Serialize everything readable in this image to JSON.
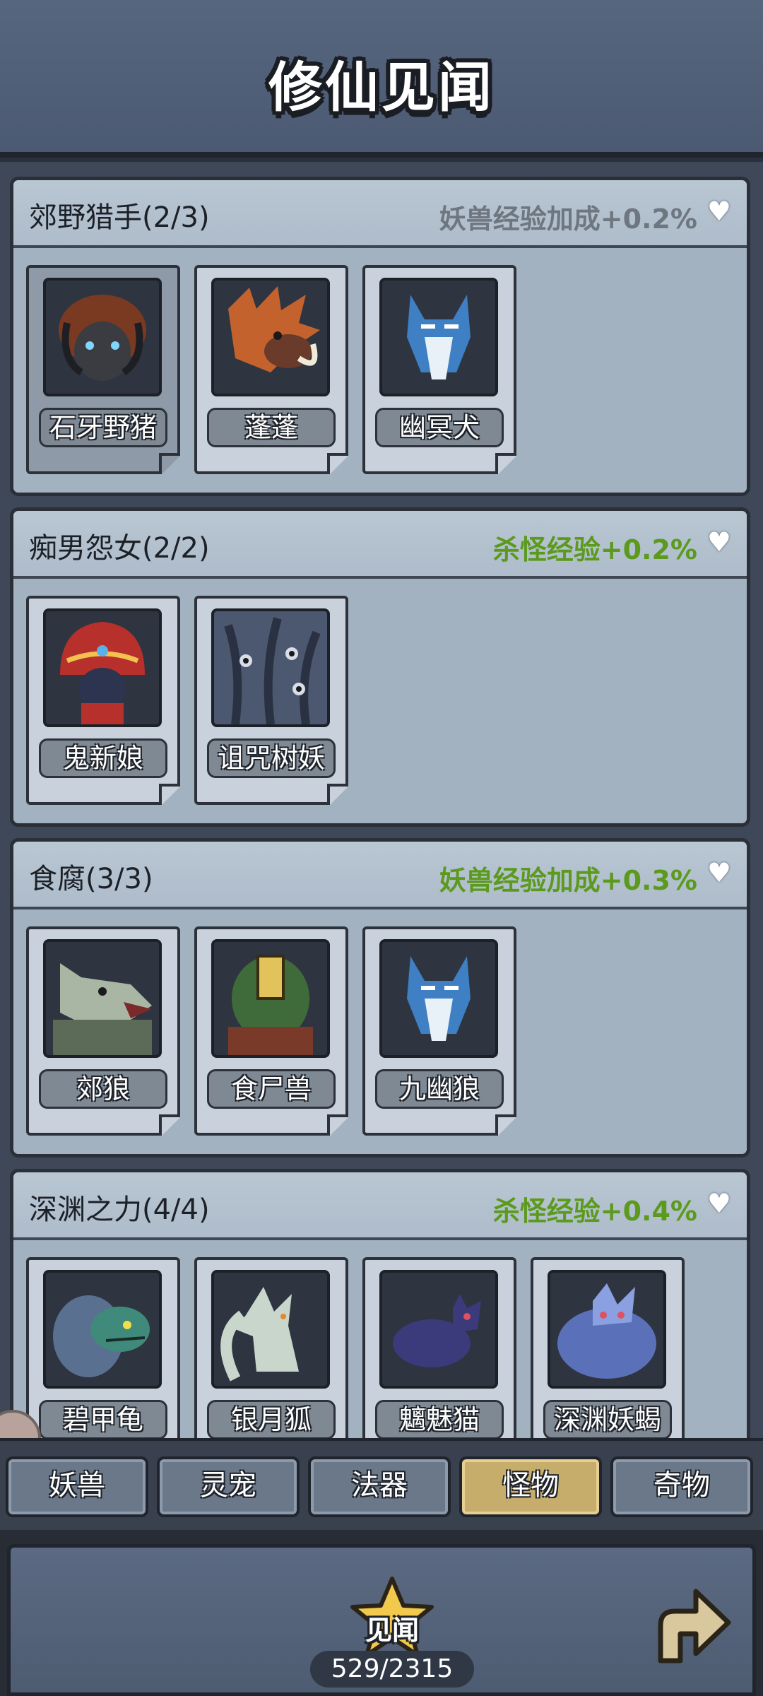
{
  "header": {
    "title": "修仙见闻"
  },
  "sets": [
    {
      "name": "郊野猎手(2/3)",
      "bonus": "妖兽经验加成+0.2%",
      "bonus_active": false,
      "monsters": [
        {
          "name": "石牙野猪",
          "icon": "boar-portrait",
          "color": "#7a3a22",
          "selected": true
        },
        {
          "name": "蓬蓬",
          "icon": "spiky-boar-portrait",
          "color": "#c4622e",
          "selected": false
        },
        {
          "name": "幽冥犬",
          "icon": "blue-wolf-portrait",
          "color": "#3f7fc4",
          "selected": false
        }
      ]
    },
    {
      "name": "痴男怨女(2/2)",
      "bonus": "杀怪经验+0.2%",
      "bonus_active": true,
      "monsters": [
        {
          "name": "鬼新娘",
          "icon": "ghost-bride-portrait",
          "color": "#b8302c",
          "selected": false
        },
        {
          "name": "诅咒树妖",
          "icon": "cursed-tree-portrait",
          "color": "#4c5870",
          "selected": false
        }
      ]
    },
    {
      "name": "食腐(3/3)",
      "bonus": "妖兽经验加成+0.3%",
      "bonus_active": true,
      "monsters": [
        {
          "name": "郊狼",
          "icon": "coyote-portrait",
          "color": "#a9b6a4",
          "selected": false
        },
        {
          "name": "食尸兽",
          "icon": "ghoul-portrait",
          "color": "#3f6b3a",
          "selected": false
        },
        {
          "name": "九幽狼",
          "icon": "blue-wolf-portrait",
          "color": "#3f7fc4",
          "selected": false
        }
      ]
    },
    {
      "name": "深渊之力(4/4)",
      "bonus": "杀怪经验+0.4%",
      "bonus_active": true,
      "monsters": [
        {
          "name": "碧甲龟",
          "icon": "turtle-portrait",
          "color": "#3f8a7a",
          "selected": false
        },
        {
          "name": "银月狐",
          "icon": "silver-fox-portrait",
          "color": "#c8d6cc",
          "selected": false
        },
        {
          "name": "魑魅猫",
          "icon": "shadow-cat-portrait",
          "color": "#3b3a7a",
          "selected": false
        },
        {
          "name": "深渊妖蝎",
          "icon": "abyss-scorpion-portrait",
          "color": "#5a70b8",
          "selected": false
        }
      ]
    }
  ],
  "tabs": [
    {
      "label": "妖兽",
      "active": false
    },
    {
      "label": "灵宠",
      "active": false
    },
    {
      "label": "法器",
      "active": false
    },
    {
      "label": "怪物",
      "active": true
    },
    {
      "label": "奇物",
      "active": false
    }
  ],
  "footer": {
    "star_label": "见闻",
    "progress": "529/2315",
    "star_icon": "star-icon",
    "return_icon": "return-arrow-icon"
  },
  "colors": {
    "bonus_inactive": "#6e7680",
    "bonus_active": "#5c9a1e",
    "tab_active": "#c7ad6c",
    "tab_normal": "#6a7889"
  }
}
